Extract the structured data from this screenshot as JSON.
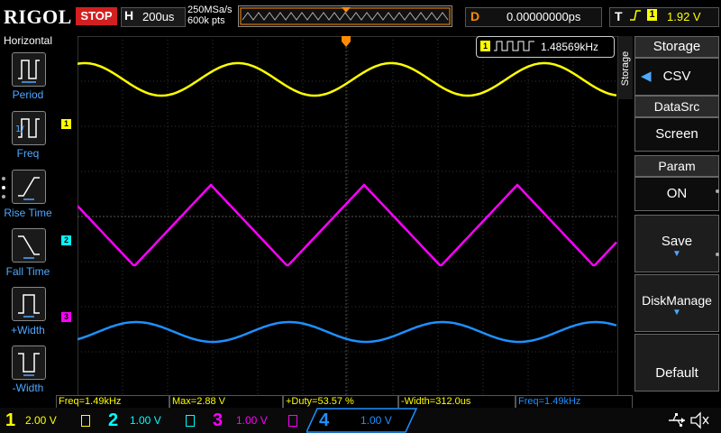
{
  "header": {
    "brand": "RIGOL",
    "run_state": "STOP",
    "timebase_letter": "H",
    "timebase": "200us",
    "sample_rate": "250MSa/s",
    "mem_depth": "600k pts",
    "delay_letter": "D",
    "delay": "0.00000000ps",
    "trigger_letter": "T",
    "trigger_channel": "1",
    "trigger_level": "1.92 V"
  },
  "left_menu": {
    "title": "Horizontal",
    "items": [
      {
        "label": "Period"
      },
      {
        "label": "Freq"
      },
      {
        "label": "Rise Time"
      },
      {
        "label": "Fall Time"
      },
      {
        "label": "+Width"
      },
      {
        "label": "-Width"
      }
    ]
  },
  "screen": {
    "freq_readout": "1.48569kHz",
    "ch_markers": [
      "1",
      "2",
      "3"
    ]
  },
  "right_menu": {
    "side_label": "Storage",
    "title": "Storage",
    "csv": "CSV",
    "datasrc_label": "DataSrc",
    "datasrc_value": "Screen",
    "param_label": "Param",
    "param_value": "ON",
    "save": "Save",
    "disk_manage": "DiskManage",
    "default": "Default"
  },
  "measurements": [
    "Freq=1.49kHz",
    "Max=2.88 V",
    "+Duty=53.57 %",
    "-Width=312.0us",
    "Freq=1.49kHz"
  ],
  "channels": [
    {
      "num": "1",
      "scale": "2.00 V",
      "color": "#ffff00"
    },
    {
      "num": "2",
      "scale": "1.00 V",
      "color": "#00ffff"
    },
    {
      "num": "3",
      "scale": "1.00 V",
      "color": "#ff00ff"
    },
    {
      "num": "4",
      "scale": "1.00 V",
      "color": "#1e90ff"
    }
  ],
  "colors": {
    "ch1": "#ffff00",
    "ch2": "#00ffff",
    "ch3": "#ff00ff",
    "ch4": "#1e90ff",
    "accent": "#ff8c00"
  }
}
